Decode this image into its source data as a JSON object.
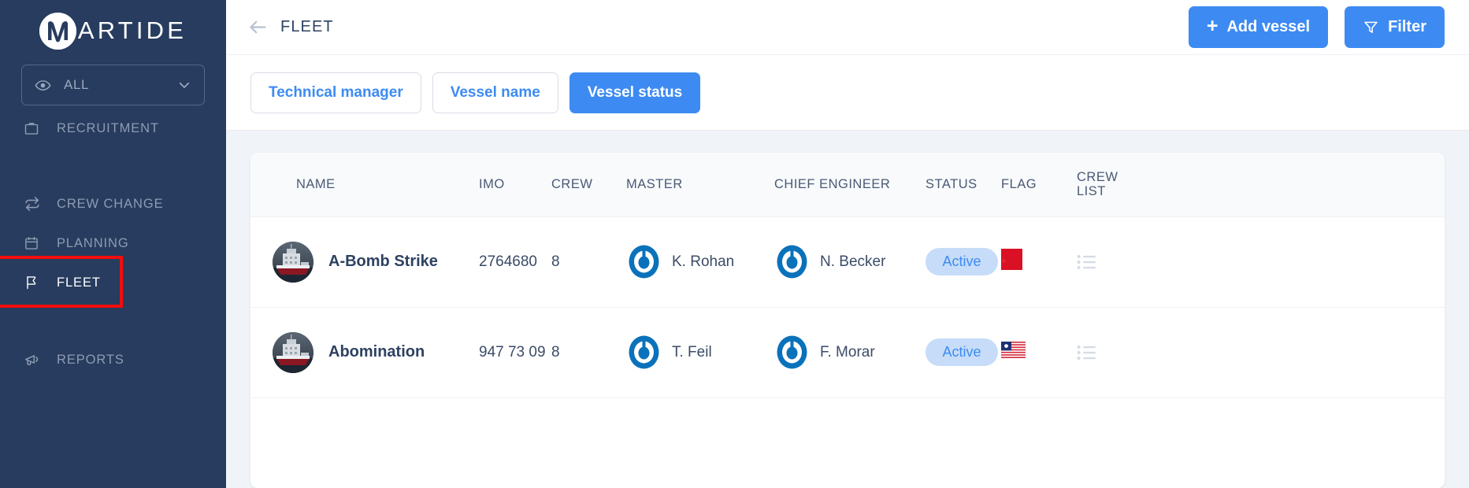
{
  "brand": {
    "logo_mark": "m-circle-logo",
    "name": "ARTIDE"
  },
  "sidebar": {
    "view_filter": {
      "icon": "eye-icon",
      "label": "ALL",
      "chevron": "chevron-down-icon"
    },
    "items": [
      {
        "label": "RECRUITMENT",
        "icon": "briefcase-icon",
        "active": false
      },
      {
        "label": "CREW CHANGE",
        "icon": "exchange-icon",
        "active": false
      },
      {
        "label": "PLANNING",
        "icon": "calendar-icon",
        "active": false
      },
      {
        "label": "FLEET",
        "icon": "flag-icon",
        "active": true
      },
      {
        "label": "REPORTS",
        "icon": "megaphone-icon",
        "active": false
      }
    ]
  },
  "topbar": {
    "back_icon": "arrow-left-icon",
    "title": "FLEET",
    "add_vessel": {
      "label": "Add vessel",
      "icon": "plus-icon"
    },
    "filter": {
      "label": "Filter",
      "icon": "funnel-icon"
    }
  },
  "tabs": [
    {
      "label": "Technical manager",
      "selected": false
    },
    {
      "label": "Vessel name",
      "selected": false
    },
    {
      "label": "Vessel status",
      "selected": true
    }
  ],
  "table": {
    "columns": {
      "name": "NAME",
      "imo": "IMO",
      "crew": "CREW",
      "master": "MASTER",
      "chief_engineer": "CHIEF ENGINEER",
      "status": "STATUS",
      "flag": "FLAG",
      "crew_list_line1": "CREW",
      "crew_list_line2": "LIST"
    },
    "rows": [
      {
        "name": "A-Bomb Strike",
        "imo": "2764680",
        "crew": "8",
        "master": "K. Rohan",
        "chief_engineer": "N. Becker",
        "status": "Active",
        "flag": "red-square-flag",
        "crew_list_icon": "list-icon"
      },
      {
        "name": "Abomination",
        "imo": "947 73 09",
        "crew": "8",
        "master": "T. Feil",
        "chief_engineer": "F. Morar",
        "status": "Active",
        "flag": "united-states-flag",
        "crew_list_icon": "list-icon"
      }
    ]
  },
  "colors": {
    "sidebar_bg": "#273c5e",
    "accent_blue": "#3d8bf2",
    "status_pill_bg": "#c6dcf9",
    "content_bg": "#f0f3f8",
    "highlight_box": "#f30d0d",
    "flag_red": "#da1025"
  }
}
